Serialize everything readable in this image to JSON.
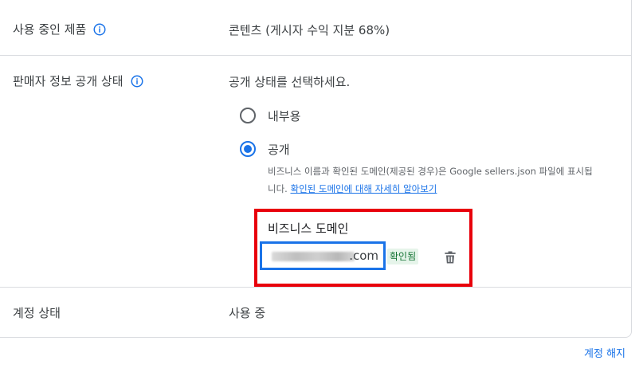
{
  "product_row": {
    "label": "사용 중인 제품",
    "value": "콘텐츠 (게시자 수익 지분 68%)"
  },
  "disclosure_row": {
    "label": "판매자 정보 공개 상태",
    "prompt": "공개 상태를 선택하세요.",
    "options": [
      {
        "label": "내부용",
        "selected": false
      },
      {
        "label": "공개",
        "selected": true
      }
    ],
    "help_text": "비즈니스 이름과 확인된 도메인(제공된 경우)은 Google sellers.json 파일에 표시됩니다.",
    "help_link": "확인된 도메인에 대해 자세히 알아보기"
  },
  "business_domain": {
    "title": "비즈니스 도메인",
    "domain_suffix": ".com",
    "status_badge": "확인됨"
  },
  "account_row": {
    "label": "계정 상태",
    "value": "사용 중"
  },
  "footer": {
    "cancel_account": "계정 해지"
  },
  "colors": {
    "accent": "#1a73e8",
    "highlight_box": "#e8000b",
    "verified_bg": "#e6f4ea",
    "verified_text": "#137333"
  },
  "icons": {
    "info": "info-icon",
    "delete": "trash-icon"
  }
}
